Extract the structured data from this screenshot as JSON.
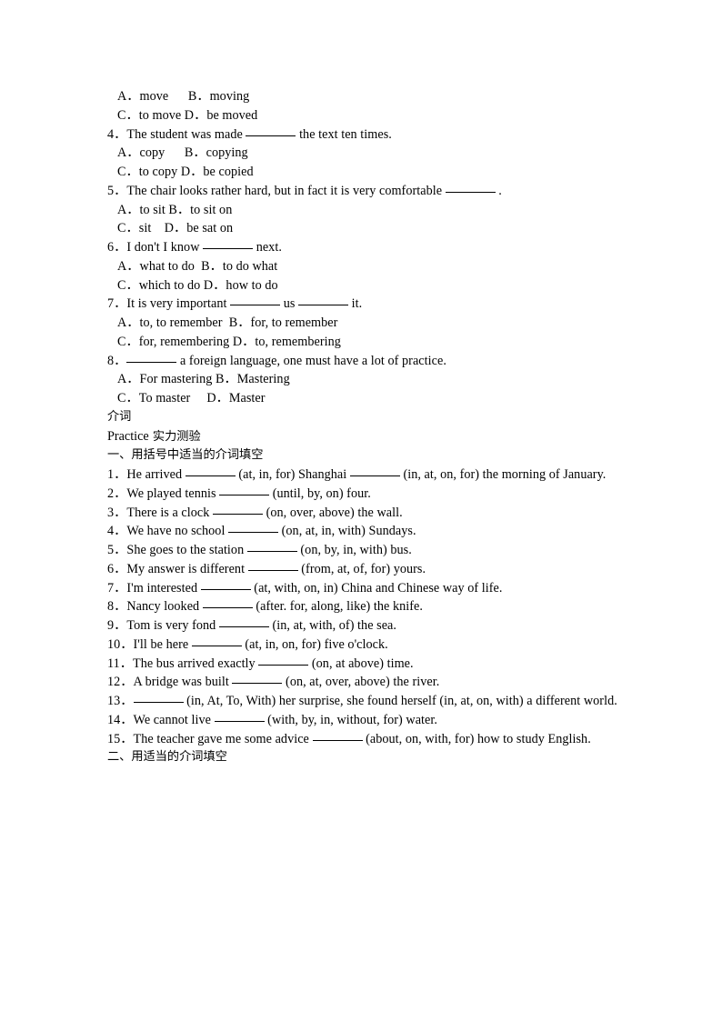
{
  "document": {
    "type": "worksheet",
    "page_background": "#ffffff",
    "text_color": "#000000"
  },
  "grammar_section": {
    "questions": [
      {
        "id": "q3-options",
        "option_lines": [
          "A．move      B．moving",
          "C．to move D．be moved"
        ]
      },
      {
        "id": "q4",
        "number": "4．",
        "stem_before": "The student was made ",
        "stem_after": " the text ten times.",
        "option_lines": [
          "A．copy      B．copying",
          "C．to copy D．be copied"
        ]
      },
      {
        "id": "q5",
        "number": "5．",
        "stem_before": "The chair looks rather hard, but in fact it is very comfortable ",
        "stem_after": " .",
        "option_lines": [
          "A．to sit B．to sit on",
          "C．sit    D．be sat on"
        ]
      },
      {
        "id": "q6",
        "number": "6．",
        "stem_before": "I don't I know ",
        "stem_after": " next.",
        "option_lines": [
          "A．what to do  B．to do what",
          "C．which to do D．how to do"
        ]
      },
      {
        "id": "q7",
        "number": "7．",
        "stem_before": "It is very important ",
        "stem_middle": " us ",
        "stem_after": " it.",
        "option_lines": [
          "A．to, to remember  B．for, to remember",
          "C．for, remembering D．to, remembering"
        ]
      },
      {
        "id": "q8",
        "number": "8．",
        "stem_before": "",
        "stem_after": " a foreign language, one must have a lot of practice.",
        "option_lines": [
          "A．For mastering B．Mastering",
          "C．To master     D．Master"
        ]
      }
    ]
  },
  "preposition_section": {
    "title": "介词",
    "practice_label_latin": "Practice",
    "practice_label_han": "实力测验",
    "part_one_heading": "一、用括号中适当的介词填空",
    "part_two_heading": "二、用适当的介词填空",
    "exercises": [
      {
        "number": "1．",
        "segments": [
          "He arrived ",
          "BLANK",
          " (at, in, for) Shanghai ",
          "BLANK",
          " (in, at, on, for) the morning of January."
        ]
      },
      {
        "number": "2．",
        "segments": [
          "We played tennis ",
          "BLANK",
          " (until, by, on) four."
        ]
      },
      {
        "number": "3．",
        "segments": [
          "There is a clock ",
          "BLANK",
          " (on, over, above) the wall."
        ]
      },
      {
        "number": "4．",
        "segments": [
          "We have no school ",
          "BLANK",
          " (on, at, in, with) Sundays."
        ]
      },
      {
        "number": "5．",
        "segments": [
          "She goes to the station ",
          "BLANK",
          " (on, by, in, with) bus."
        ]
      },
      {
        "number": "6．",
        "segments": [
          "My answer is different ",
          "BLANK",
          " (from, at, of, for) yours."
        ]
      },
      {
        "number": "7．",
        "segments": [
          "I'm interested ",
          "BLANK",
          " (at, with, on, in) China and Chinese way of life."
        ]
      },
      {
        "number": "8．",
        "segments": [
          "Nancy looked ",
          "BLANK",
          " (after. for, along, like) the knife."
        ]
      },
      {
        "number": "9．",
        "segments": [
          "Tom is very fond ",
          "BLANK",
          " (in, at, with, of) the sea."
        ]
      },
      {
        "number": "10．",
        "segments": [
          "I'll be here ",
          "BLANK",
          " (at, in, on, for) five o'clock."
        ]
      },
      {
        "number": "11．",
        "segments": [
          "The bus arrived exactly ",
          "BLANK",
          " (on, at above) time."
        ]
      },
      {
        "number": "12．",
        "segments": [
          "A bridge was built ",
          "BLANK",
          " (on, at, over, above) the river."
        ]
      },
      {
        "number": "13．",
        "segments": [
          "",
          "BLANK",
          " (in, At, To, With) her surprise, she found herself (in, at, on, with) a different world."
        ]
      },
      {
        "number": "14．",
        "segments": [
          "We cannot live ",
          "BLANK",
          " (with, by, in, without, for) water."
        ]
      },
      {
        "number": "15．",
        "segments": [
          "The teacher gave me some advice ",
          "BLANK",
          " (about, on, with, for) how to study English."
        ]
      }
    ]
  }
}
